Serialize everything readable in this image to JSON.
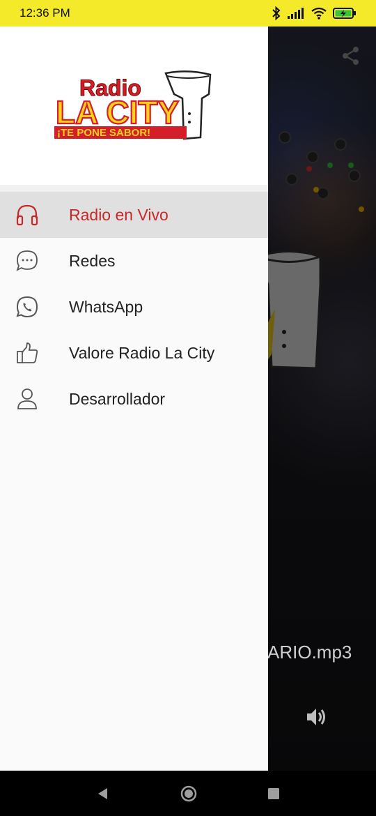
{
  "status_bar": {
    "time": "12:36 PM",
    "icons": [
      "bluetooth-icon",
      "signal-icon",
      "wifi-icon",
      "battery-charging-icon"
    ]
  },
  "background_app": {
    "share_icon": "share-icon",
    "file_name_fragment": "ARIO.mp3",
    "volume_icon": "volume-icon"
  },
  "drawer": {
    "logo": {
      "line1": "Radio",
      "line2": "LA CITY",
      "tagline": "¡TE PONE SABOR!"
    },
    "items": [
      {
        "label": "Radio en Vivo",
        "icon": "headphones-icon",
        "active": true
      },
      {
        "label": "Redes",
        "icon": "chat-bubble-icon",
        "active": false
      },
      {
        "label": "WhatsApp",
        "icon": "whatsapp-icon",
        "active": false
      },
      {
        "label": "Valore Radio La City",
        "icon": "thumbs-up-icon",
        "active": false
      },
      {
        "label": "Desarrollador",
        "icon": "person-icon",
        "active": false
      }
    ]
  },
  "colors": {
    "status_bar_bg": "#f5ea2a",
    "active_text": "#c62828",
    "active_bg": "#e0e0e0",
    "logo_red": "#d41f2a",
    "logo_yellow": "#f7d21c"
  },
  "nav_bar": {
    "buttons": [
      "back-icon",
      "home-icon",
      "recents-icon"
    ]
  }
}
